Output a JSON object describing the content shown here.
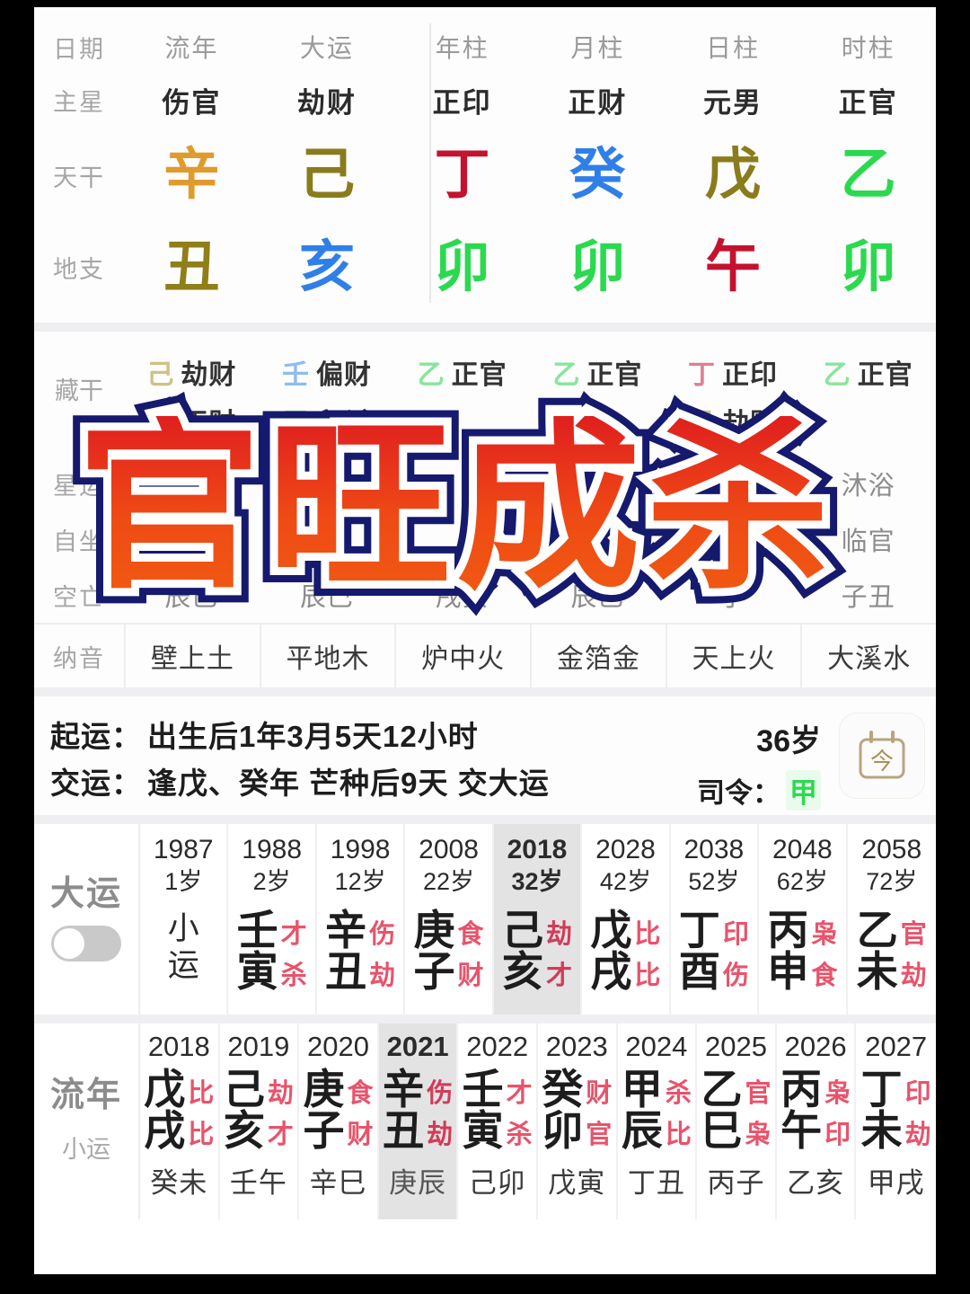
{
  "overlay": {
    "text": "官旺成杀",
    "gradient_from": "#e01f1f",
    "gradient_to": "#f05a12",
    "stroke_outer": "#151a6e",
    "stroke_inner": "#ffffff"
  },
  "pillars_table": {
    "row_labels": [
      "日期",
      "主星",
      "天干",
      "地支"
    ],
    "columns": [
      {
        "head": "流年",
        "main_star": "伤官",
        "stem": "辛",
        "stem_el": "metal",
        "branch": "丑",
        "branch_el": "earth"
      },
      {
        "head": "大运",
        "main_star": "劫财",
        "stem": "己",
        "stem_el": "earth",
        "branch": "亥",
        "branch_el": "water"
      },
      {
        "head": "年柱",
        "main_star": "正印",
        "stem": "丁",
        "stem_el": "fire",
        "branch": "卯",
        "branch_el": "wood"
      },
      {
        "head": "月柱",
        "main_star": "正财",
        "stem": "癸",
        "stem_el": "water",
        "branch": "卯",
        "branch_el": "wood"
      },
      {
        "head": "日柱",
        "main_star": "元男",
        "stem": "戊",
        "stem_el": "earth",
        "branch": "午",
        "branch_el": "fire"
      },
      {
        "head": "时柱",
        "main_star": "正官",
        "stem": "乙",
        "stem_el": "wood",
        "branch": "卯",
        "branch_el": "wood"
      }
    ]
  },
  "hidden_stems": {
    "label": "藏干",
    "columns": [
      {
        "items": [
          {
            "stem": "己",
            "el": "earth",
            "name": "劫财"
          },
          {
            "stem": "癸",
            "el": "water",
            "name": "正财"
          }
        ]
      },
      {
        "items": [
          {
            "stem": "壬",
            "el": "water",
            "name": "偏财"
          },
          {
            "stem": "甲",
            "el": "wood",
            "name": "七杀"
          }
        ]
      },
      {
        "items": [
          {
            "stem": "乙",
            "el": "wood",
            "name": "正官"
          }
        ]
      },
      {
        "items": [
          {
            "stem": "乙",
            "el": "wood",
            "name": "正官"
          }
        ]
      },
      {
        "items": [
          {
            "stem": "丁",
            "el": "fire",
            "name": "正印"
          },
          {
            "stem": "己",
            "el": "earth",
            "name": "劫财"
          }
        ]
      },
      {
        "items": [
          {
            "stem": "乙",
            "el": "wood",
            "name": "正官"
          }
        ]
      }
    ]
  },
  "extra_rows": [
    {
      "label": "星运",
      "values": [
        "",
        "",
        "",
        "",
        "",
        "沐浴"
      ]
    },
    {
      "label": "自坐",
      "values": [
        "",
        "",
        "",
        "病",
        "",
        "临官"
      ]
    },
    {
      "label": "空亡",
      "values": [
        "辰巳",
        "辰巳",
        "戌亥",
        "辰巳",
        "子",
        "子丑"
      ]
    }
  ],
  "nayin": {
    "label": "纳音",
    "values": [
      "壁上土",
      "平地木",
      "炉中火",
      "金箔金",
      "天上火",
      "大溪水"
    ]
  },
  "luck_info": {
    "start_key": "起运：",
    "start_value": "出生后1年3月5天12小时",
    "change_key": "交运：",
    "change_value": "逢戊、癸年 芒种后9天 交大运",
    "age": "36岁",
    "siling_key": "司令：",
    "siling_value": "甲",
    "today_button": "今"
  },
  "dayun": {
    "label": "大运",
    "toggle_on": false,
    "columns": [
      {
        "year": "1987",
        "age": "1岁",
        "vertical": "小运",
        "stem": "",
        "stem_tag": "",
        "branch": "",
        "branch_tag": "",
        "active": false
      },
      {
        "year": "1988",
        "age": "2岁",
        "stem": "壬",
        "stem_tag": "才",
        "branch": "寅",
        "branch_tag": "杀",
        "active": false
      },
      {
        "year": "1998",
        "age": "12岁",
        "stem": "辛",
        "stem_tag": "伤",
        "branch": "丑",
        "branch_tag": "劫",
        "active": false
      },
      {
        "year": "2008",
        "age": "22岁",
        "stem": "庚",
        "stem_tag": "食",
        "branch": "子",
        "branch_tag": "财",
        "active": false
      },
      {
        "year": "2018",
        "age": "32岁",
        "stem": "己",
        "stem_tag": "劫",
        "branch": "亥",
        "branch_tag": "才",
        "active": true
      },
      {
        "year": "2028",
        "age": "42岁",
        "stem": "戊",
        "stem_tag": "比",
        "branch": "戌",
        "branch_tag": "比",
        "active": false
      },
      {
        "year": "2038",
        "age": "52岁",
        "stem": "丁",
        "stem_tag": "印",
        "branch": "酉",
        "branch_tag": "伤",
        "active": false
      },
      {
        "year": "2048",
        "age": "62岁",
        "stem": "丙",
        "stem_tag": "枭",
        "branch": "申",
        "branch_tag": "食",
        "active": false
      },
      {
        "year": "2058",
        "age": "72岁",
        "stem": "乙",
        "stem_tag": "官",
        "branch": "未",
        "branch_tag": "劫",
        "active": false
      }
    ]
  },
  "liunian": {
    "label": "流年",
    "sublabel": "小运",
    "columns": [
      {
        "year": "2018",
        "stem": "戊",
        "stem_tag": "比",
        "branch": "戌",
        "branch_tag": "比",
        "small": "癸未",
        "active": false
      },
      {
        "year": "2019",
        "stem": "己",
        "stem_tag": "劫",
        "branch": "亥",
        "branch_tag": "才",
        "small": "壬午",
        "active": false
      },
      {
        "year": "2020",
        "stem": "庚",
        "stem_tag": "食",
        "branch": "子",
        "branch_tag": "财",
        "small": "辛巳",
        "active": false
      },
      {
        "year": "2021",
        "stem": "辛",
        "stem_tag": "伤",
        "branch": "丑",
        "branch_tag": "劫",
        "small": "庚辰",
        "active": true
      },
      {
        "year": "2022",
        "stem": "壬",
        "stem_tag": "才",
        "branch": "寅",
        "branch_tag": "杀",
        "small": "己卯",
        "active": false
      },
      {
        "year": "2023",
        "stem": "癸",
        "stem_tag": "财",
        "branch": "卯",
        "branch_tag": "官",
        "small": "戊寅",
        "active": false
      },
      {
        "year": "2024",
        "stem": "甲",
        "stem_tag": "杀",
        "branch": "辰",
        "branch_tag": "比",
        "small": "丁丑",
        "active": false
      },
      {
        "year": "2025",
        "stem": "乙",
        "stem_tag": "官",
        "branch": "巳",
        "branch_tag": "枭",
        "small": "丙子",
        "active": false
      },
      {
        "year": "2026",
        "stem": "丙",
        "stem_tag": "枭",
        "branch": "午",
        "branch_tag": "印",
        "small": "乙亥",
        "active": false
      },
      {
        "year": "2027",
        "stem": "丁",
        "stem_tag": "印",
        "branch": "未",
        "branch_tag": "劫",
        "small": "甲戌",
        "active": false
      }
    ]
  }
}
